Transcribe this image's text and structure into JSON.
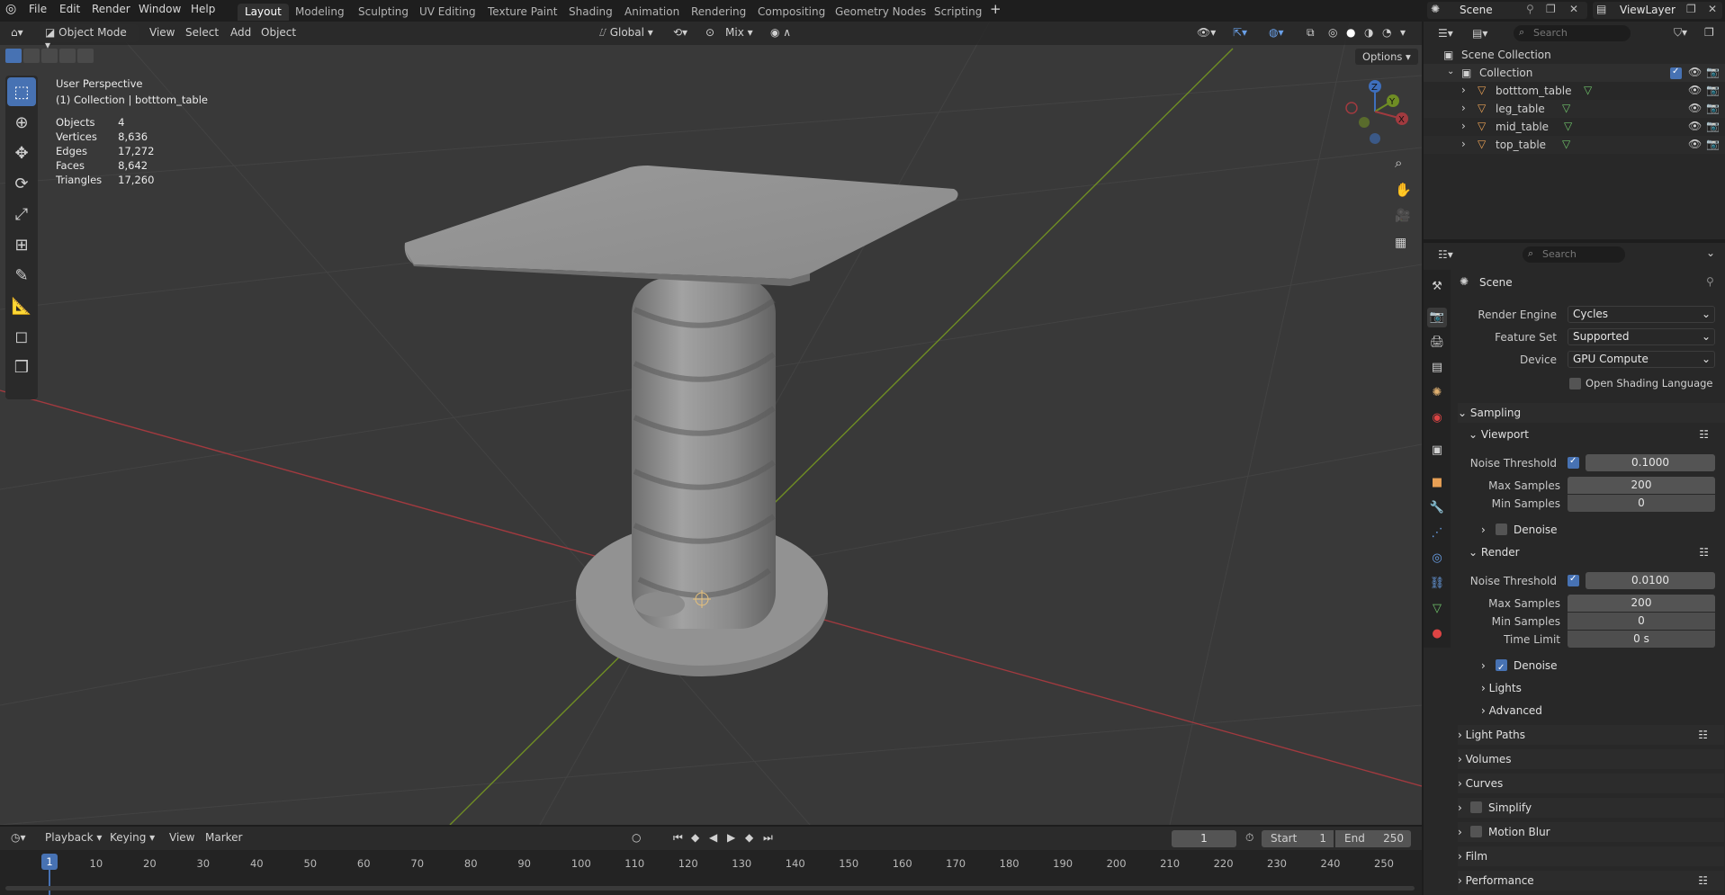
{
  "topbar": {
    "menus": [
      "File",
      "Edit",
      "Render",
      "Window",
      "Help"
    ],
    "workspaces": [
      "Layout",
      "Modeling",
      "Sculpting",
      "UV Editing",
      "Texture Paint",
      "Shading",
      "Animation",
      "Rendering",
      "Compositing",
      "Geometry Nodes",
      "Scripting"
    ],
    "active_workspace": "Layout",
    "add_tab": "+",
    "scene": "Scene",
    "view_layer": "ViewLayer"
  },
  "viewport": {
    "mode": "Object Mode",
    "menus": [
      "View",
      "Select",
      "Add",
      "Object"
    ],
    "orientation": "Global",
    "snap_mix": "Mix",
    "options": "Options",
    "perspective": "User Perspective",
    "collection_line": "(1) Collection | botttom_table",
    "stats": [
      {
        "label": "Objects",
        "value": "4"
      },
      {
        "label": "Vertices",
        "value": "8,636"
      },
      {
        "label": "Edges",
        "value": "17,272"
      },
      {
        "label": "Faces",
        "value": "8,642"
      },
      {
        "label": "Triangles",
        "value": "17,260"
      }
    ],
    "gizmo_axes": {
      "x": "X",
      "y": "Y",
      "z": "Z"
    }
  },
  "outliner": {
    "search_placeholder": "Search",
    "root": "Scene Collection",
    "collection": "Collection",
    "items": [
      "botttom_table",
      "leg_table",
      "mid_table",
      "top_table"
    ]
  },
  "properties": {
    "search_placeholder": "Search",
    "context": "Scene",
    "render_engine_label": "Render Engine",
    "render_engine": "Cycles",
    "feature_set_label": "Feature Set",
    "feature_set": "Supported",
    "device_label": "Device",
    "device": "GPU Compute",
    "osl_label": "Open Shading Language",
    "sampling": "Sampling",
    "viewport_section": "Viewport",
    "noise_threshold_label": "Noise Threshold",
    "viewport_noise": "0.1000",
    "max_samples_label": "Max Samples",
    "viewport_max": "200",
    "min_samples_label": "Min Samples",
    "viewport_min": "0",
    "denoise_label": "Denoise",
    "render_section": "Render",
    "render_noise": "0.0100",
    "render_max": "200",
    "render_min": "0",
    "time_limit_label": "Time Limit",
    "time_limit": "0 s",
    "lights": "Lights",
    "advanced": "Advanced",
    "panels": [
      "Light Paths",
      "Volumes",
      "Curves",
      "Simplify",
      "Motion Blur",
      "Film",
      "Performance"
    ]
  },
  "timeline": {
    "menus": [
      "Playback",
      "Keying",
      "View",
      "Marker"
    ],
    "current_frame": "1",
    "start_label": "Start",
    "start": "1",
    "end_label": "End",
    "end": "250",
    "ticks": [
      "1",
      "10",
      "20",
      "30",
      "40",
      "50",
      "60",
      "70",
      "80",
      "90",
      "100",
      "110",
      "120",
      "130",
      "140",
      "150",
      "160",
      "170",
      "180",
      "190",
      "200",
      "210",
      "220",
      "230",
      "240",
      "250"
    ]
  },
  "colors": {
    "accent": "#4772b3",
    "x_axis": "#a13a3f",
    "y_axis": "#6f8d24",
    "z_axis": "#3e6fbd"
  }
}
